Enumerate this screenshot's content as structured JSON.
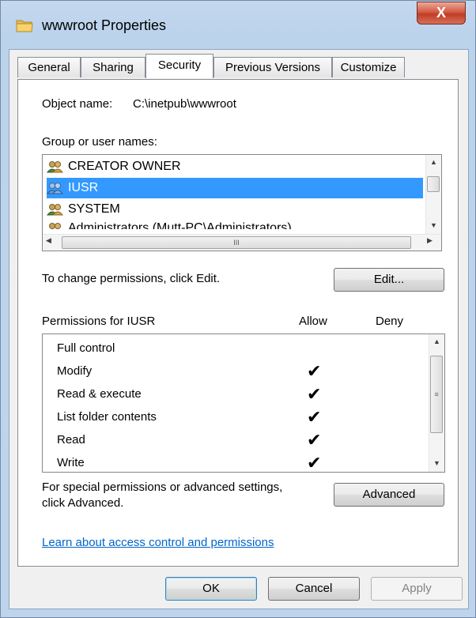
{
  "window": {
    "title": "wwwroot Properties",
    "close_label": "X"
  },
  "tabs": [
    {
      "label": "General"
    },
    {
      "label": "Sharing"
    },
    {
      "label": "Security"
    },
    {
      "label": "Previous Versions"
    },
    {
      "label": "Customize"
    }
  ],
  "security": {
    "object_name_label": "Object name:",
    "object_name_value": "C:\\inetpub\\wwwroot",
    "group_label": "Group or user names:",
    "users": [
      {
        "name": "CREATOR OWNER",
        "icon": "users-group-icon"
      },
      {
        "name": "IUSR",
        "icon": "users-group-icon"
      },
      {
        "name": "SYSTEM",
        "icon": "users-group-icon"
      },
      {
        "name": "Administrators (Mutt-PC\\Administrators)",
        "icon": "users-group-icon"
      }
    ],
    "selected_user": "IUSR",
    "change_hint": "To change permissions, click Edit.",
    "edit_button": "Edit...",
    "permissions_header": "Permissions for IUSR",
    "allow_header": "Allow",
    "deny_header": "Deny",
    "permissions": [
      {
        "name": "Full control",
        "allow": false,
        "deny": false
      },
      {
        "name": "Modify",
        "allow": true,
        "deny": false
      },
      {
        "name": "Read & execute",
        "allow": true,
        "deny": false
      },
      {
        "name": "List folder contents",
        "allow": true,
        "deny": false
      },
      {
        "name": "Read",
        "allow": true,
        "deny": false
      },
      {
        "name": "Write",
        "allow": true,
        "deny": false
      }
    ],
    "advanced_hint_line1": "For special permissions or advanced settings,",
    "advanced_hint_line2": "click Advanced.",
    "advanced_button": "Advanced",
    "learn_link": "Learn about access control and permissions"
  },
  "footer": {
    "ok": "OK",
    "cancel": "Cancel",
    "apply": "Apply"
  },
  "colors": {
    "selection": "#3399ff",
    "link": "#0066cc"
  }
}
